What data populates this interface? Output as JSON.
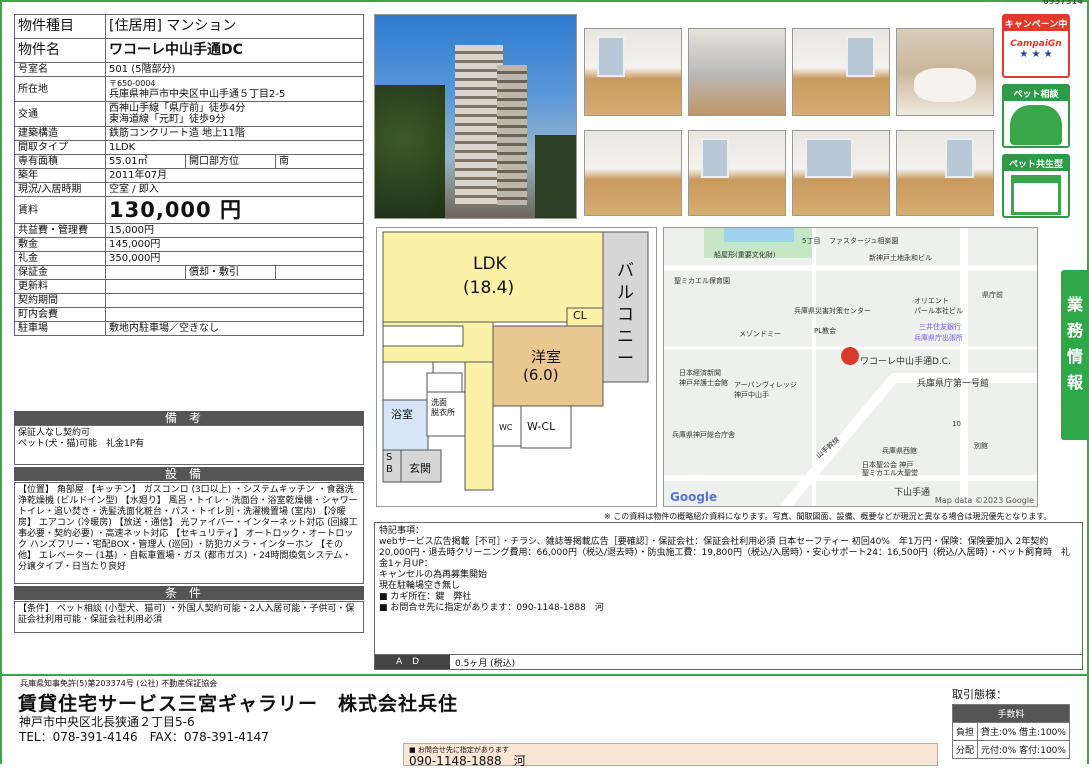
{
  "doc_no": "6937314",
  "spec": [
    {
      "k": "物件種目",
      "v": "[住居用] マンション",
      "big": true
    },
    {
      "k": "物件名",
      "v": "ワコーレ中山手通DC",
      "big": true,
      "bold": true
    },
    {
      "k": "号室名",
      "v": "501 (5階部分)"
    },
    {
      "k": "所在地",
      "v": "〒650-0004",
      "v2": "兵庫県神戸市中央区中山手通５丁目2-5"
    },
    {
      "k": "交通",
      "v": "西神山手線「県庁前」徒歩4分",
      "v2": "東海道線「元町」徒歩9分"
    },
    {
      "k": "建築構造",
      "v": "鉄筋コンクリート造 地上11階"
    },
    {
      "k": "間取タイプ",
      "v": "1LDK"
    },
    {
      "k": "専有面積",
      "v": "55.01㎡",
      "k2": "開口部方位",
      "v3": "南"
    },
    {
      "k": "築年",
      "v": "2011年07月"
    },
    {
      "k": "現況/入居時期",
      "v": "空室 / 即入"
    },
    {
      "k": "賃料",
      "v": "130,000 円",
      "rent": true
    },
    {
      "k": "共益費・管理費",
      "v": "15,000円"
    },
    {
      "k": "敷金",
      "v": "145,000円"
    },
    {
      "k": "礼金",
      "v": "350,000円"
    },
    {
      "k": "保証金",
      "v": "",
      "k2": "償却・敷引",
      "v3": ""
    },
    {
      "k": "更新料",
      "v": ""
    },
    {
      "k": "契約期間",
      "v": ""
    },
    {
      "k": "町内会費",
      "v": ""
    },
    {
      "k": "駐車場",
      "v": "敷地内駐車場／空きなし"
    }
  ],
  "bikou_title": "備考",
  "bikou": "保証人なし契約可\nペット(犬・猫)可能　礼金1P有",
  "setsubi_title": "設備",
  "setsubi": "【位置】 角部屋 【キッチン】 ガスコンロ (3口以上) ・システムキッチン ・食器洗浄乾燥機 (ビルドイン型) 【水廻り】 風呂・トイレ・洗面台・浴室乾燥機・シャワートイレ・追い焚き・洗髪洗面化粧台・バス・トイレ別・洗濯機置場 (室内) 【冷暖房】 エアコン (冷暖房) 【放送・通信】 光ファイバー・インターネット対応 (回線工事必要・契約必要) ・高速ネット対応 【セキュリティ】 オートロック・オートロック ハンズフリー・宅配BOX・管理人 (巡回) ・防犯カメラ・インターホン 【その他】 エレベーター (1基) ・自転車置場・ガス (都市ガス) ・24時間換気システム・分譲タイプ・日当たり良好",
  "joken_title": "条件",
  "joken": "【条件】 ペット相談 (小型犬、猫可) ・外国人契約可能・2人入居可能・子供可・保証会社利用可能・保証会社利用必須",
  "badges": {
    "campaign": "キャンペーン中",
    "campaign_sub": "CampaiGn",
    "pet_soudan": "ペット相談",
    "pet_kyousei": "ペット共生型"
  },
  "plan": {
    "ldk": "LDK",
    "ldk_size": "(18.4)",
    "balcony": "バルコニー",
    "cl": "CL",
    "yoshitsu": "洋室",
    "yoshitsu_size": "(6.0)",
    "yokushitsu": "浴室",
    "senmen": "洗面\n脱衣所",
    "wc": "WC",
    "wcl": "W-CL",
    "sb": "S\nB",
    "genkan": "玄関"
  },
  "map": {
    "labels": [
      "5丁目",
      "ファスタージュ相楽園",
      "船屋形(重要文化財)",
      "新神戸土地永和ビル",
      "聖ミカエル保育園",
      "県庁前",
      "兵庫県災害対策センター",
      "オリエント",
      "パール本社ビル",
      "三井住友銀行",
      "兵庫県庁出張所",
      "メゾンドミー",
      "PL教会",
      "ワコーレ中山手通D.C.",
      "兵庫県庁第一号館",
      "日本経済新聞",
      "神戸弁護士会館",
      "アーバンヴィレッジ",
      "神戸中山手",
      "兵庫県神戸総合庁舎",
      "10",
      "山手幹線",
      "兵庫県西館",
      "別館",
      "日本聖公会 神戸",
      "聖ミカエル大聖堂",
      "下山手通",
      "2",
      "神戸市",
      "兵庫県神戸総合庁舎"
    ],
    "google": "Google",
    "copyright": "Map data ©2023 Google"
  },
  "notice": "※ この資料は物件の概略紹介資料になります。写真、間取図面、設備、概要などが現況と異なる場合は現況優先となります。",
  "remarks_title": "特記事項：",
  "remarks": "webサービス広告掲載［不可］・チラシ、雑誌等掲載広告［要確認］・保証会社：保証会社利用必須 日本セーフティー 初回40%　年1万円・保険：保険要加入 2年契約 20,000円・退去時クリーニング費用：66,000円（税込/退去時）・防虫施工費：19,800円（税込/入居時）・安心サポート24：16,500円（税込/入居時）・ペット飼育時　礼金1ヶ月UP：\nキャンセルの為再募集開始\n現在駐輪場空き無し\n■ カギ所在：鍵　弊社\n■ お問合せ先に指定があります：090-1148-1888　河",
  "ad_label": "AD",
  "ad_value": "0.5ヶ月 (税込)",
  "footer": {
    "license": "兵庫県知事免許(5)第203374号 (公社) 不動産保証協会",
    "company": "賃貸住宅サービス三宮ギャラリー　株式会社兵住",
    "address": "神戸市中央区北長狭通２丁目5-6",
    "tel": "TEL：078-391-4146　FAX：078-391-4147",
    "terms_title": "取引態様：",
    "fee_header": "手数料",
    "fee_rows": [
      {
        "k": "負担",
        "v": "貸主:0% 借主:100%"
      },
      {
        "k": "分配",
        "v": "元付:0% 客付:100%"
      }
    ],
    "contact_label": "■ お問合せ先に指定があります",
    "contact_phone": "090-1148-1888　河"
  }
}
